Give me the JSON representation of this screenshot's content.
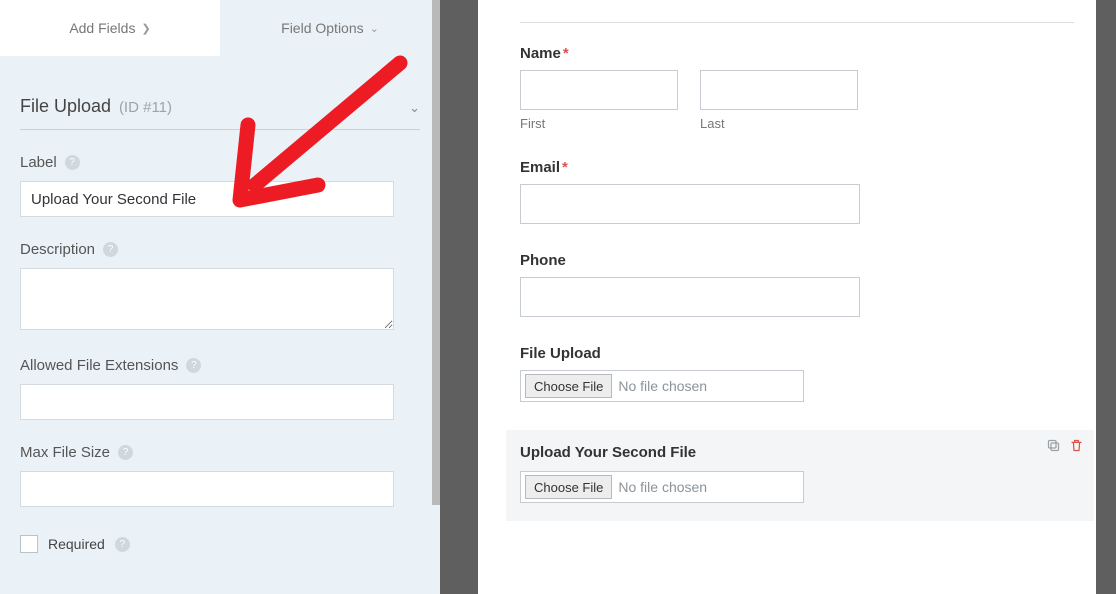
{
  "tabs": {
    "add_fields": "Add Fields",
    "field_options": "Field Options"
  },
  "section": {
    "title": "File Upload",
    "id_text": "(ID #11)"
  },
  "options": {
    "label_title": "Label",
    "label_value": "Upload Your Second File",
    "description_title": "Description",
    "description_value": "",
    "ext_title": "Allowed File Extensions",
    "ext_value": "",
    "max_title": "Max File Size",
    "max_value": "",
    "required_title": "Required"
  },
  "preview": {
    "name_label": "Name",
    "first_sub": "First",
    "last_sub": "Last",
    "email_label": "Email",
    "phone_label": "Phone",
    "file1_label": "File Upload",
    "choose_btn": "Choose File",
    "no_file": "No file chosen",
    "file2_label": "Upload Your Second File"
  }
}
